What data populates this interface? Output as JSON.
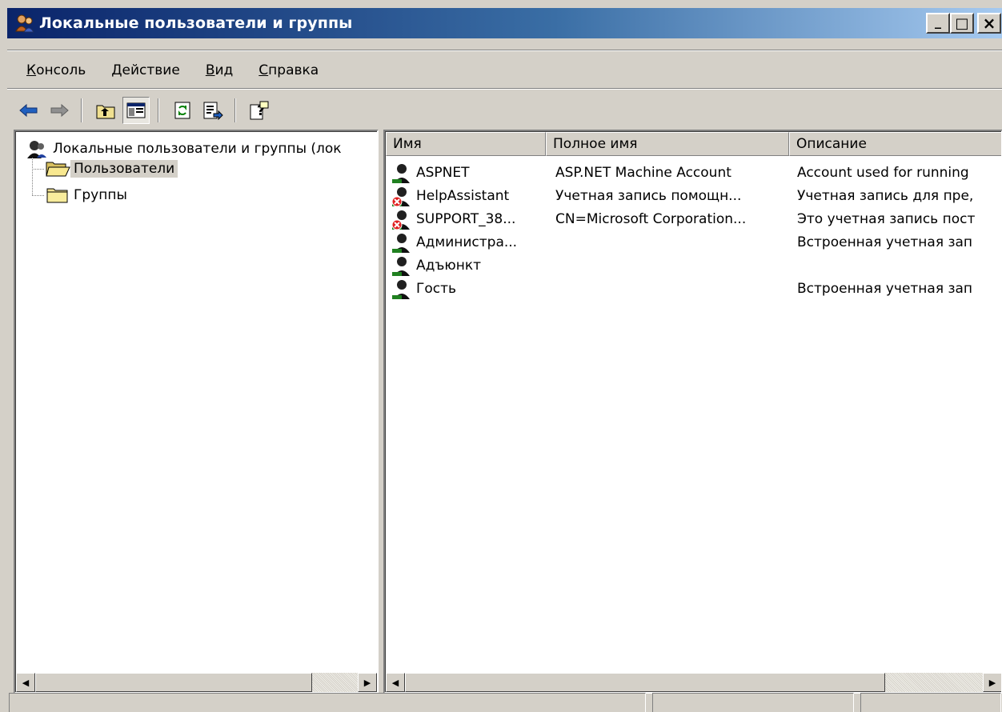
{
  "window": {
    "title": "Локальные пользователи и группы",
    "minimize_label": "_",
    "maximize_label": "□",
    "close_label": "×"
  },
  "menu": {
    "items": [
      {
        "label": "Консоль",
        "hotkey": "К",
        "rest": "онсоль"
      },
      {
        "label": "Действие",
        "hotkey": "Д",
        "rest": "ействие"
      },
      {
        "label": "Вид",
        "hotkey": "В",
        "rest": "ид"
      },
      {
        "label": "Справка",
        "hotkey": "С",
        "rest": "правка"
      }
    ]
  },
  "toolbar": {
    "buttons": [
      "back-icon",
      "forward-icon",
      "up-one-level-icon",
      "show-hide-tree-icon",
      "refresh-icon",
      "export-list-icon",
      "help-icon"
    ]
  },
  "tree": {
    "root_label": "Локальные пользователи и группы (лок",
    "children": [
      {
        "label": "Пользователи",
        "selected": true
      },
      {
        "label": "Группы",
        "selected": false
      }
    ]
  },
  "list": {
    "columns": [
      "Имя",
      "Полное имя",
      "Описание"
    ],
    "rows": [
      {
        "name": "ASPNET",
        "full_name": "ASP.NET Machine Account",
        "description": "Account used for running",
        "disabled": false
      },
      {
        "name": "HelpAssistant",
        "full_name": "Учетная запись помощн...",
        "description": "Учетная запись для пре,",
        "disabled": true
      },
      {
        "name": "SUPPORT_38...",
        "full_name": "CN=Microsoft Corporation...",
        "description": "Это учетная запись пост",
        "disabled": true
      },
      {
        "name": "Администра...",
        "full_name": "",
        "description": "Встроенная учетная зап",
        "disabled": false
      },
      {
        "name": "Адъюнкт",
        "full_name": "",
        "description": "",
        "disabled": false
      },
      {
        "name": "Гость",
        "full_name": "",
        "description": "Встроенная учетная зап",
        "disabled": false
      }
    ]
  },
  "colors": {
    "title_gradient_start": "#0a246a",
    "title_gradient_end": "#a6caf0",
    "face": "#d4d0c8"
  }
}
